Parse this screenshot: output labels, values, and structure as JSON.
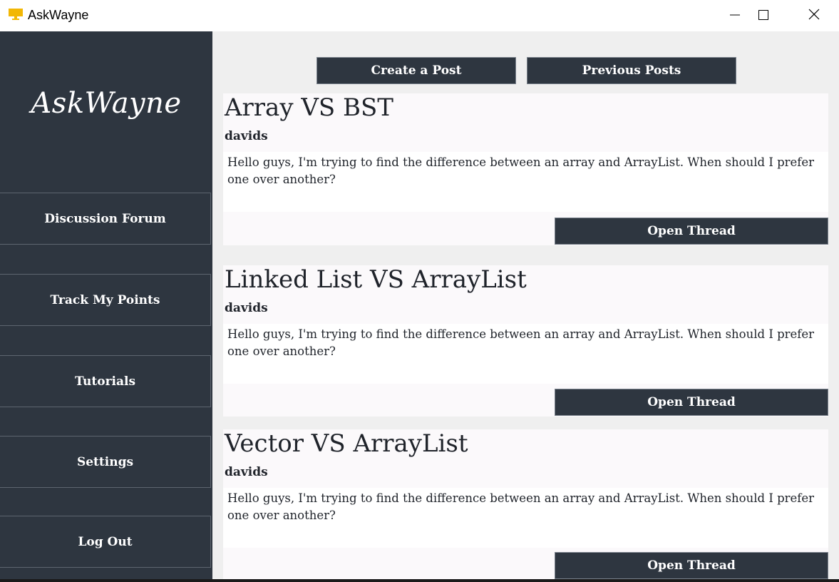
{
  "window": {
    "title": "AskWayne",
    "minimize_glyph": "—",
    "maximize_glyph": "☐",
    "close_glyph": "✕"
  },
  "sidebar": {
    "logo": "AskWayne",
    "items": [
      {
        "label": "Discussion Forum"
      },
      {
        "label": "Track My Points"
      },
      {
        "label": "Tutorials"
      },
      {
        "label": "Settings"
      },
      {
        "label": "Log Out"
      }
    ]
  },
  "main": {
    "create_post_label": "Create a Post",
    "previous_posts_label": "Previous Posts",
    "posts": [
      {
        "title": "Array VS BST",
        "author": "davids",
        "body": "Hello guys, I'm trying to find the difference between an array and ArrayList. When should I prefer one over another?",
        "open_label": "Open Thread"
      },
      {
        "title": "Linked List VS ArrayList",
        "author": "davids",
        "body": "Hello guys, I'm trying to find the difference between an array and ArrayList. When should I prefer one over another?",
        "open_label": "Open Thread"
      },
      {
        "title": "Vector VS ArrayList",
        "author": "davids",
        "body": "Hello guys, I'm trying to find the difference between an array and ArrayList. When should I prefer one over another?",
        "open_label": "Open Thread"
      }
    ]
  },
  "colors": {
    "sidebar_bg": "#2e3640",
    "main_bg": "#efefef",
    "button_bg": "#2e3640",
    "app_icon": "#f2b705"
  },
  "icons": {
    "app": "monitor-icon",
    "minimize": "minimize-icon",
    "maximize": "maximize-icon",
    "close": "close-icon"
  }
}
